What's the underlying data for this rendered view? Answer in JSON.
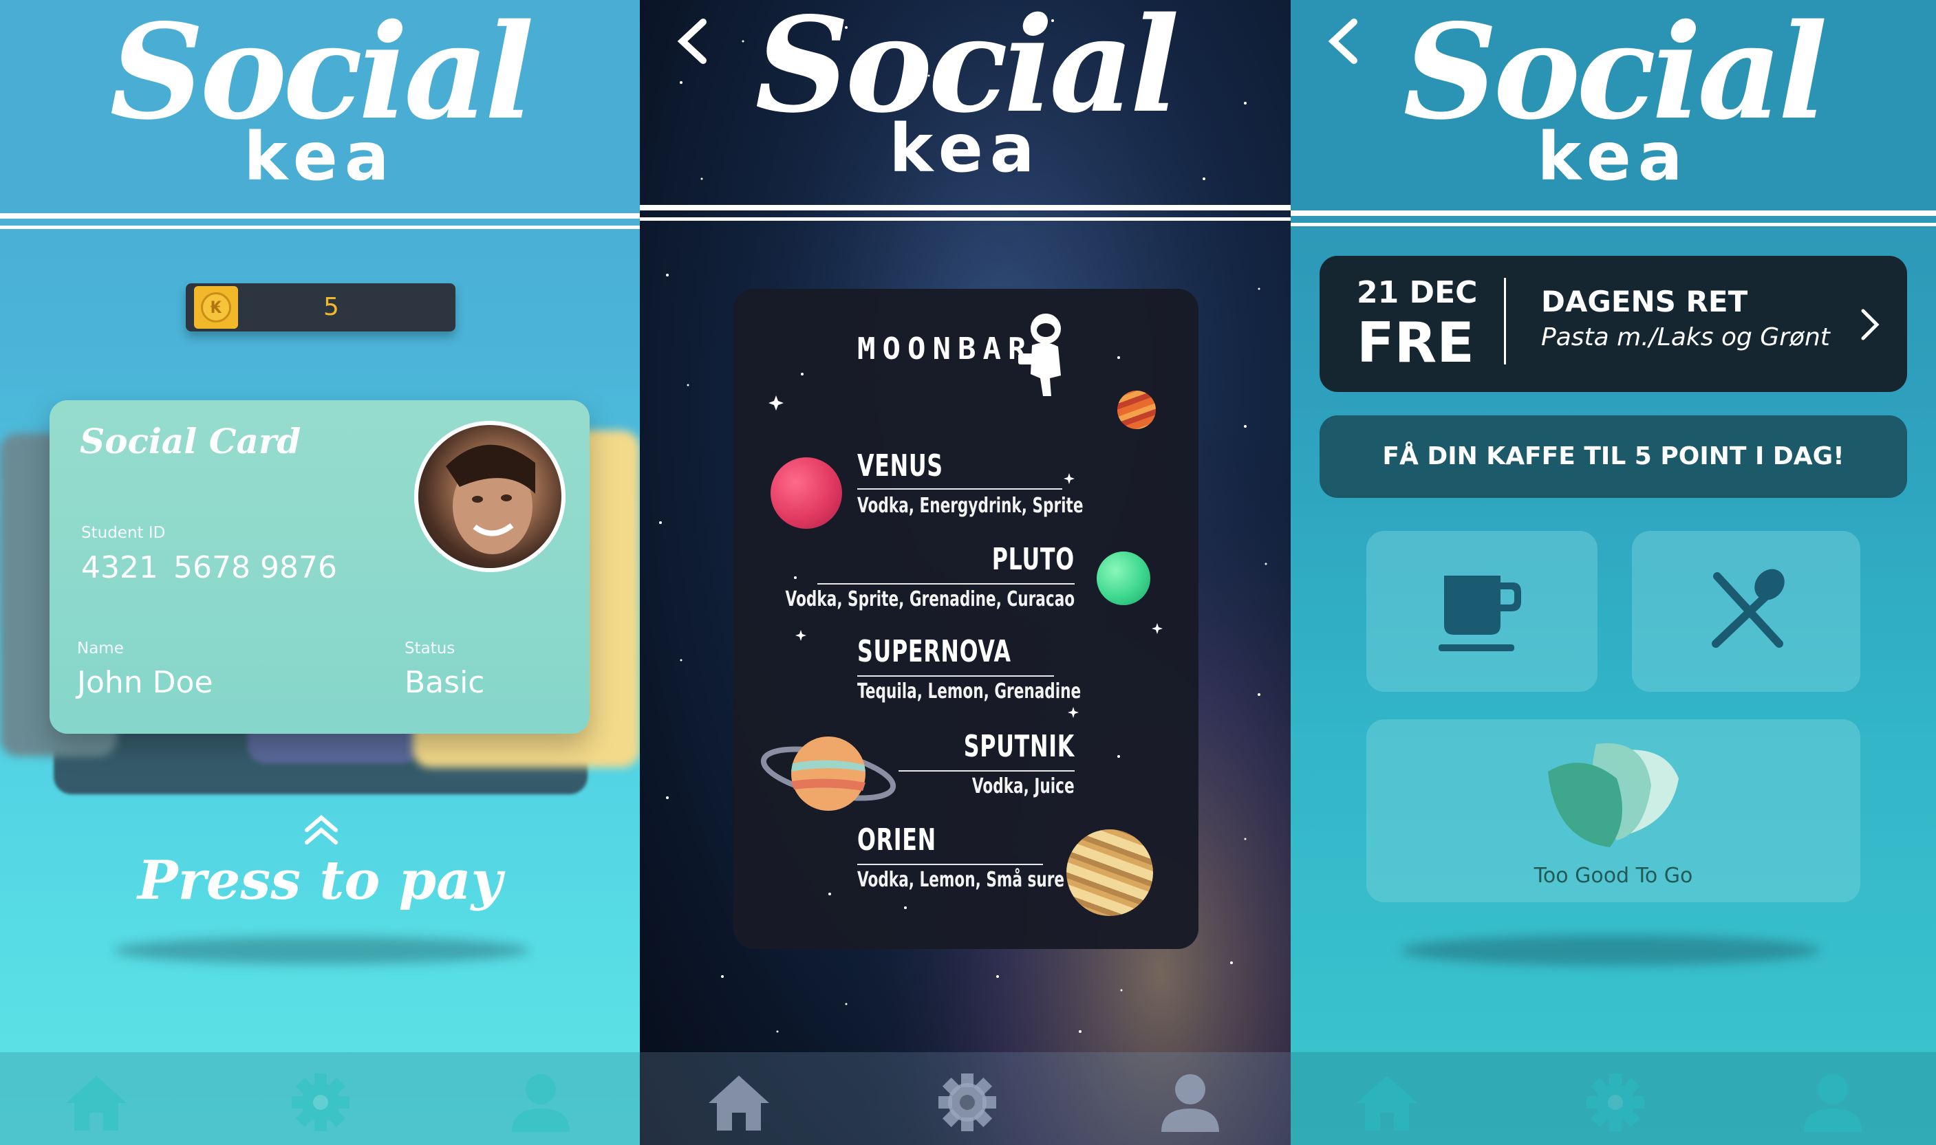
{
  "brand": {
    "social": "Social",
    "kea": "kea"
  },
  "screen1": {
    "coin_symbol": "₭",
    "coin_value": "5",
    "card": {
      "title": "Social Card",
      "student_id_label": "Student ID",
      "student_id_part1": "4321",
      "student_id_part2": "5678 9876",
      "name_label": "Name",
      "name_value": "John Doe",
      "status_label": "Status",
      "status_value": "Basic"
    },
    "press_to_pay": "Press to pay"
  },
  "screen2": {
    "menu_title": "MOONBAR",
    "drinks": [
      {
        "name": "VENUS",
        "ingredients": "Vodka, Energydrink, Sprite"
      },
      {
        "name": "PLUTO",
        "ingredients": "Vodka, Sprite, Grenadine, Curacao"
      },
      {
        "name": "SUPERNOVA",
        "ingredients": "Tequila, Lemon, Grenadine"
      },
      {
        "name": "SPUTNIK",
        "ingredients": "Vodka, Juice"
      },
      {
        "name": "ORIEN",
        "ingredients": "Vodka, Lemon, Små sure"
      }
    ]
  },
  "screen3": {
    "date_day": "21 DEC",
    "date_weekday": "FRE",
    "dish_title": "DAGENS RET",
    "dish_name": "Pasta m./Laks og Grønt",
    "kaffe_banner": "FÅ DIN KAFFE TIL 5 POINT I DAG!",
    "tgtg_label": "Too Good To Go"
  },
  "nav": {
    "icons": [
      "home-icon",
      "gear-icon",
      "user-icon"
    ]
  },
  "colors": {
    "accent_cyan": "#5ce6e6",
    "coin_gold": "#f2b82a",
    "dark_panel": "#152630"
  }
}
